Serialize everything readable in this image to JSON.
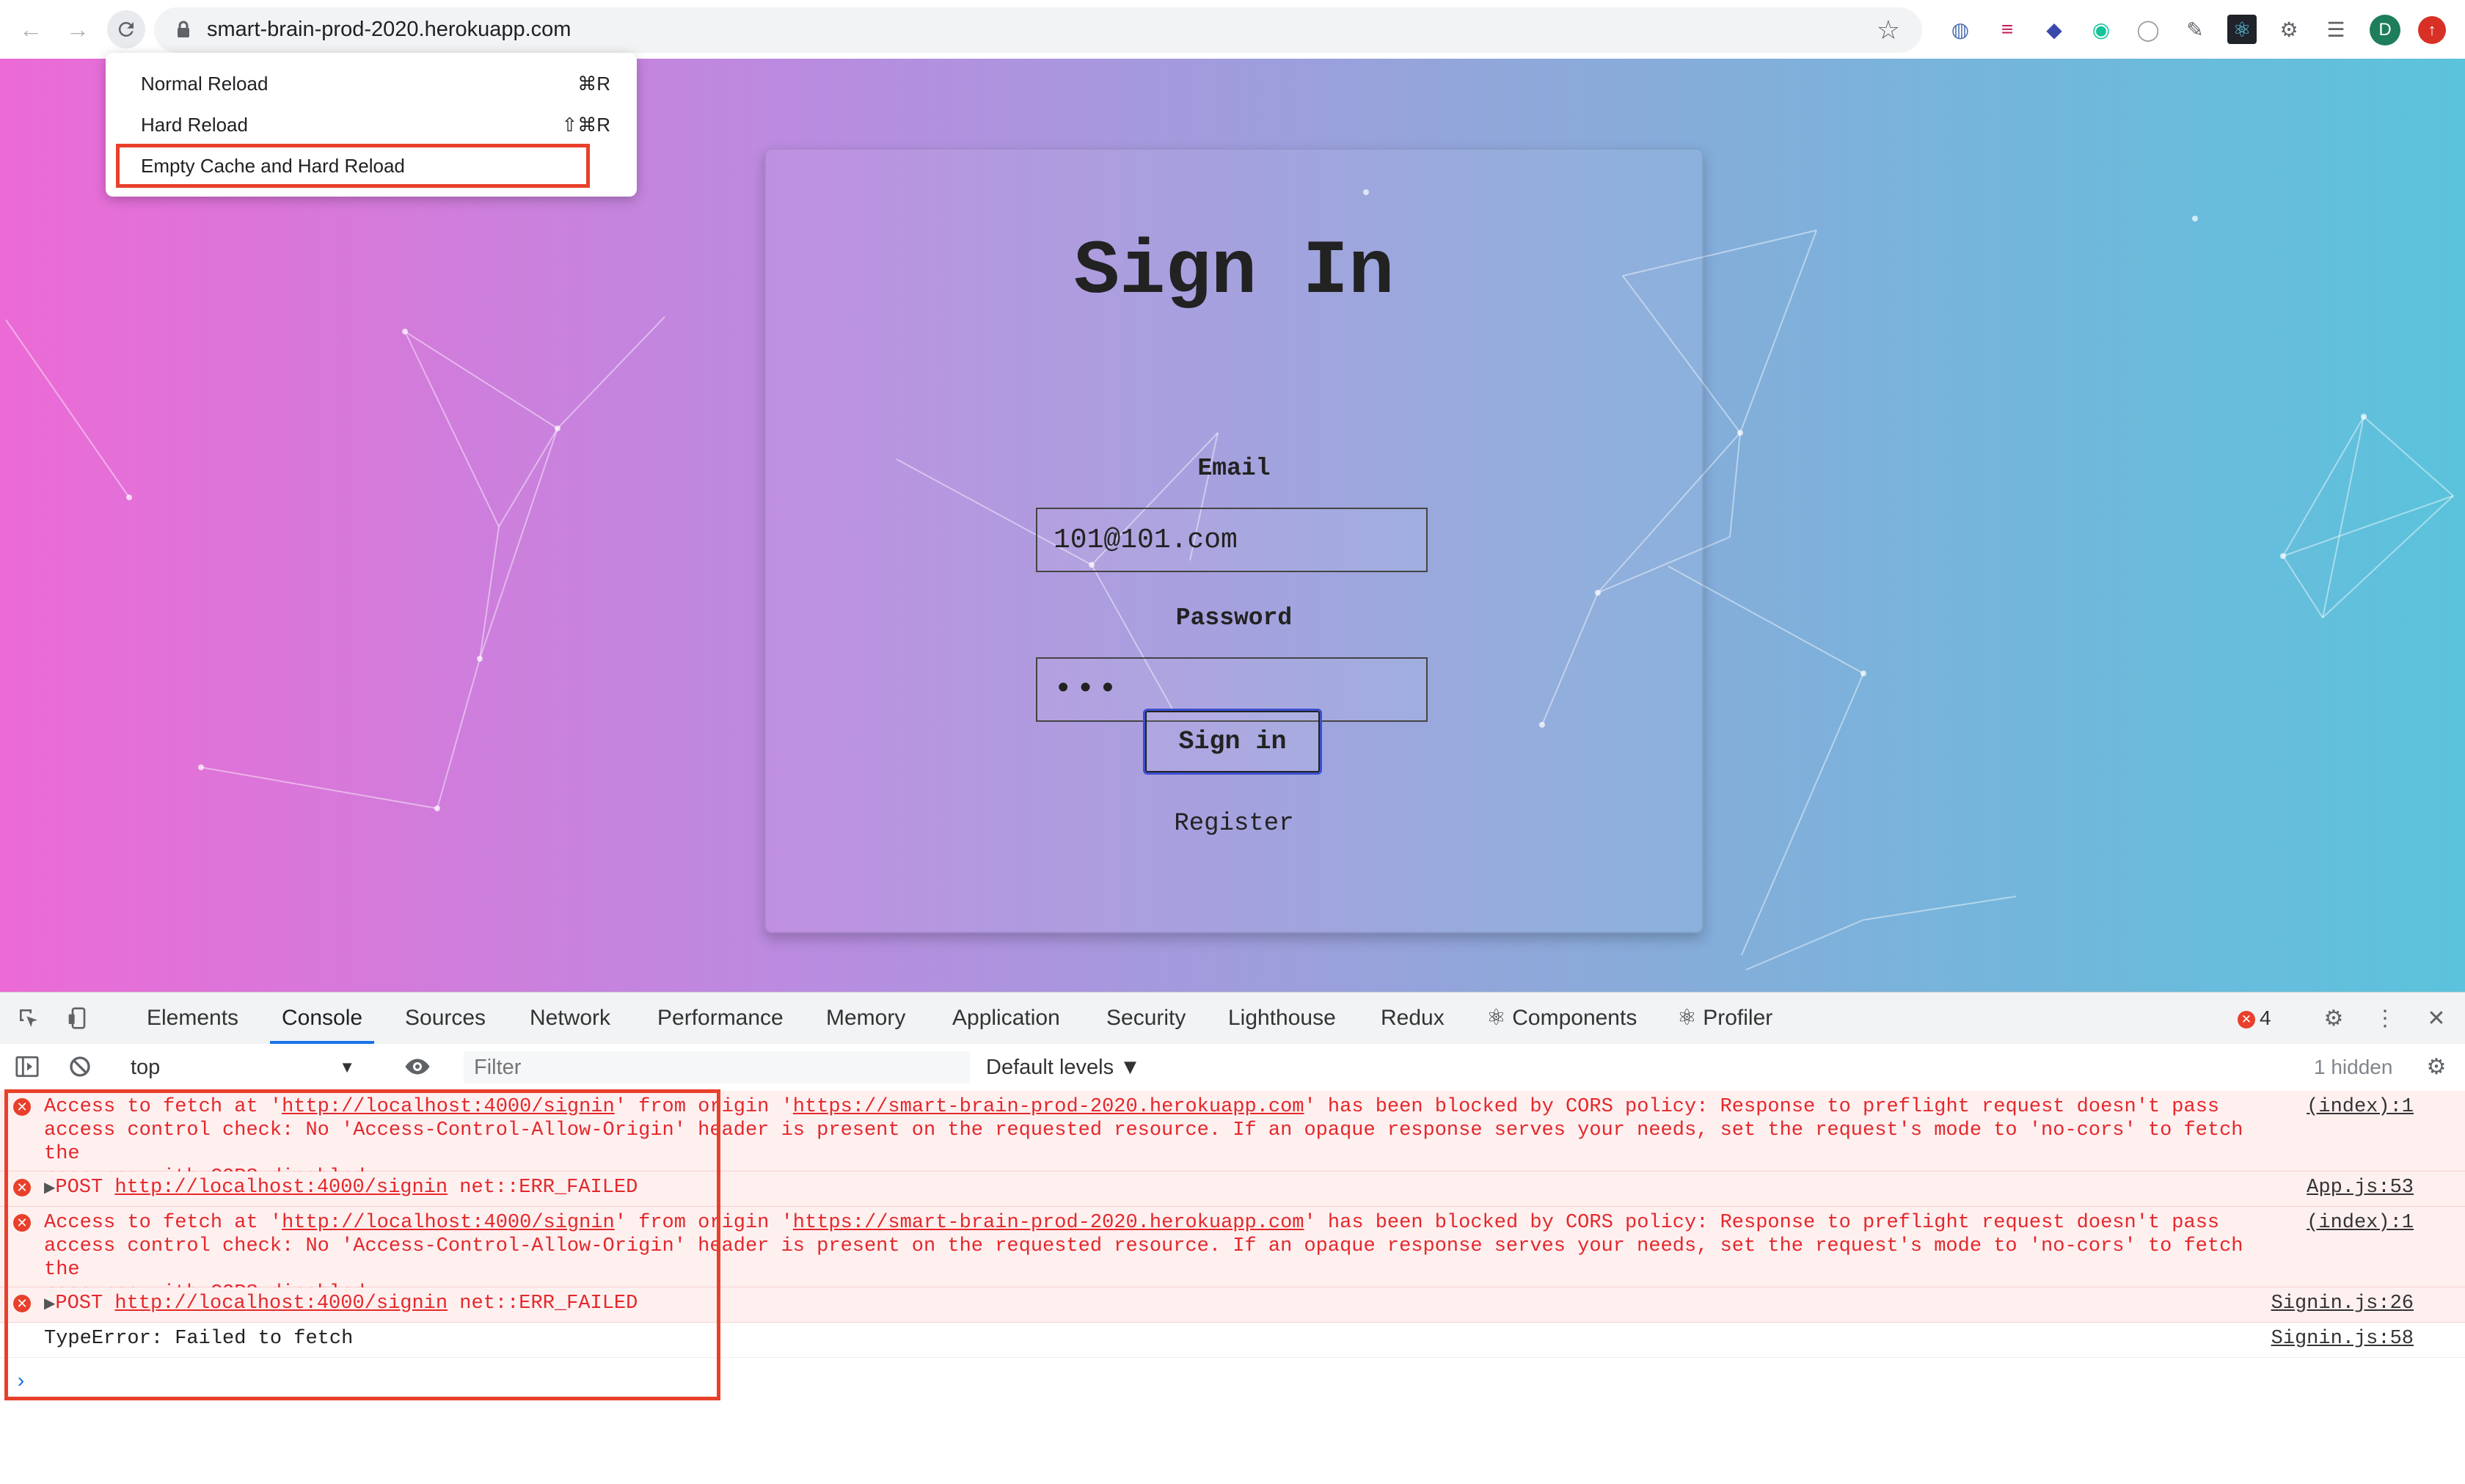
{
  "browser": {
    "url": "smart-brain-prod-2020.herokuapp.com",
    "profile_initial": "D"
  },
  "reload_menu": {
    "items": [
      {
        "label": "Normal Reload",
        "shortcut": "⌘R"
      },
      {
        "label": "Hard Reload",
        "shortcut": "⇧⌘R"
      },
      {
        "label": "Empty Cache and Hard Reload",
        "shortcut": ""
      }
    ]
  },
  "signin": {
    "title": "Sign In",
    "email_label": "Email",
    "email_value": "101@101.com",
    "password_label": "Password",
    "password_value": "•••",
    "submit_label": "Sign in",
    "register_label": "Register"
  },
  "devtools": {
    "tabs": [
      "Elements",
      "Console",
      "Sources",
      "Network",
      "Performance",
      "Memory",
      "Application",
      "Security",
      "Lighthouse",
      "Redux",
      "⚛ Components",
      "⚛ Profiler"
    ],
    "active_tab": "Console",
    "error_count": "4",
    "context": "top",
    "filter_placeholder": "Filter",
    "levels": "Default levels ▼",
    "hidden": "1 hidden",
    "messages": {
      "m1": {
        "p1": "Access to fetch at '",
        "link1": "http://localhost:4000/signin",
        "p2": "' from origin '",
        "link2": "https://smart-brain-prod-2020.herokuapp.com",
        "p3": "' has been blocked by CORS policy: Response to preflight request doesn't pass\naccess control check: No 'Access-Control-Allow-Origin' header is present on the requested resource. If an opaque response serves your needs, set the request's mode to 'no-cors' to fetch the\nresource with CORS disabled.",
        "source": "(index):1"
      },
      "m2": {
        "method": "POST",
        "link": "http://localhost:4000/signin",
        "status": "net::ERR_FAILED",
        "source": "App.js:53"
      },
      "m3": {
        "p1": "Access to fetch at '",
        "link1": "http://localhost:4000/signin",
        "p2": "' from origin '",
        "link2": "https://smart-brain-prod-2020.herokuapp.com",
        "p3": "' has been blocked by CORS policy: Response to preflight request doesn't pass\naccess control check: No 'Access-Control-Allow-Origin' header is present on the requested resource. If an opaque response serves your needs, set the request's mode to 'no-cors' to fetch the\nresource with CORS disabled.",
        "source": "(index):1"
      },
      "m4": {
        "method": "POST",
        "link": "http://localhost:4000/signin",
        "status": "net::ERR_FAILED",
        "source": "Signin.js:26"
      },
      "m5": {
        "text": "TypeError: Failed to fetch",
        "source": "Signin.js:58"
      }
    },
    "prompt": "›"
  },
  "colors": {
    "highlight": "#e8402b",
    "error_text": "#e4282b",
    "error_bg": "#fff0f0",
    "gradient_start": "#ec6ad6",
    "gradient_end": "#5bc3dc"
  }
}
